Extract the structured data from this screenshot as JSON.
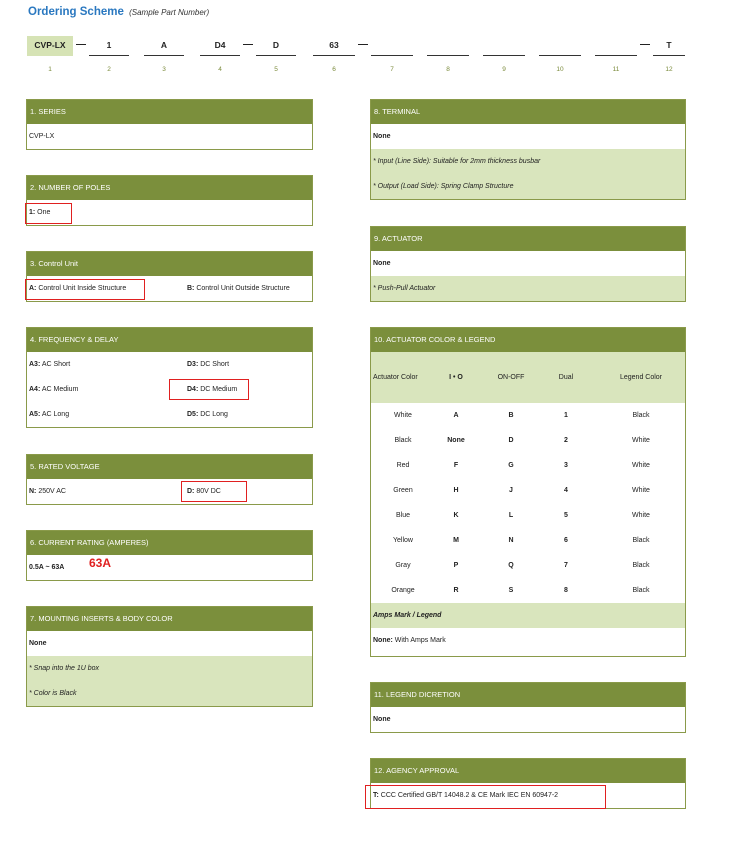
{
  "title": "Ordering Scheme",
  "subtitle": "(Sample Part Number)",
  "part_number": {
    "segments": [
      "CVP-LX",
      "1",
      "A",
      "D4",
      "D",
      "63",
      "",
      "",
      "",
      "",
      "",
      "T"
    ],
    "dash": "—",
    "positions": [
      "1",
      "2",
      "3",
      "4",
      "5",
      "6",
      "7",
      "8",
      "9",
      "10",
      "11",
      "12"
    ]
  },
  "series": {
    "header": "1. SERIES",
    "value": "CVP-LX"
  },
  "poles": {
    "header": "2. NUMBER OF POLES",
    "code": "1:",
    "text": " One"
  },
  "control_unit": {
    "header": "3. Control Unit",
    "opt_a_code": "A:",
    "opt_a_text": " Control Unit Inside Structure",
    "opt_b_code": "B:",
    "opt_b_text": " Control Unit Outside Structure"
  },
  "frequency": {
    "header": "4. FREQUENCY & DELAY",
    "left": [
      {
        "code": "A3:",
        "text": " AC Short"
      },
      {
        "code": "A4:",
        "text": " AC Medium"
      },
      {
        "code": "A5:",
        "text": " AC Long"
      }
    ],
    "right": [
      {
        "code": "D3:",
        "text": " DC Short"
      },
      {
        "code": "D4:",
        "text": " DC Medium"
      },
      {
        "code": "D5:",
        "text": " DC Long"
      }
    ]
  },
  "voltage": {
    "header": "5. RATED VOLTAGE",
    "n_code": "N:",
    "n_text": " 250V AC",
    "d_code": "D:",
    "d_text": " 80V DC"
  },
  "current": {
    "header": "6. CURRENT RATING (AMPERES)",
    "range": "0.5A ~ 63A",
    "selected": "63A"
  },
  "mounting": {
    "header": "7. MOUNTING INSERTS & BODY COLOR",
    "none": "None",
    "note1": "* Snap into the 1U box",
    "note2": "* Color is Black"
  },
  "terminal": {
    "header": "8. TERMINAL",
    "none": "None",
    "note1": "* Input (Line Side): Suitable for 2mm thickness busbar",
    "note2": "* Output (Load Side): Spring Clamp Structure"
  },
  "actuator": {
    "header": "9. ACTUATOR",
    "none": "None",
    "note": "* Push-Pull Actuator"
  },
  "actuator_color": {
    "header": "10. ACTUATOR COLOR & LEGEND",
    "columns": [
      "Actuator Color",
      "I • O",
      "ON-OFF",
      "Dual",
      "Legend Color"
    ],
    "rows": [
      [
        "White",
        "A",
        "B",
        "1",
        "Black"
      ],
      [
        "Black",
        "None",
        "D",
        "2",
        "White"
      ],
      [
        "Red",
        "F",
        "G",
        "3",
        "White"
      ],
      [
        "Green",
        "H",
        "J",
        "4",
        "White"
      ],
      [
        "Blue",
        "K",
        "L",
        "5",
        "White"
      ],
      [
        "Yellow",
        "M",
        "N",
        "6",
        "Black"
      ],
      [
        "Gray",
        "P",
        "Q",
        "7",
        "Black"
      ],
      [
        "Orange",
        "R",
        "S",
        "8",
        "Black"
      ]
    ],
    "amps_label": "Amps Mark / Legend",
    "amps_code": "None:",
    "amps_text": " With Amps Mark"
  },
  "legend_discretion": {
    "header": "11. LEGEND DICRETION",
    "none": "None"
  },
  "agency": {
    "header": "12. AGENCY APPROVAL",
    "code": "T:",
    "text": " CCC Certified GB/T 14048.2 & CE Mark IEC EN 60947-2"
  },
  "colors": {
    "header_green": "#7b8f3c",
    "row_green": "#d9e5bd",
    "title_blue": "#2a78c0",
    "highlight_red": "#e02020"
  }
}
